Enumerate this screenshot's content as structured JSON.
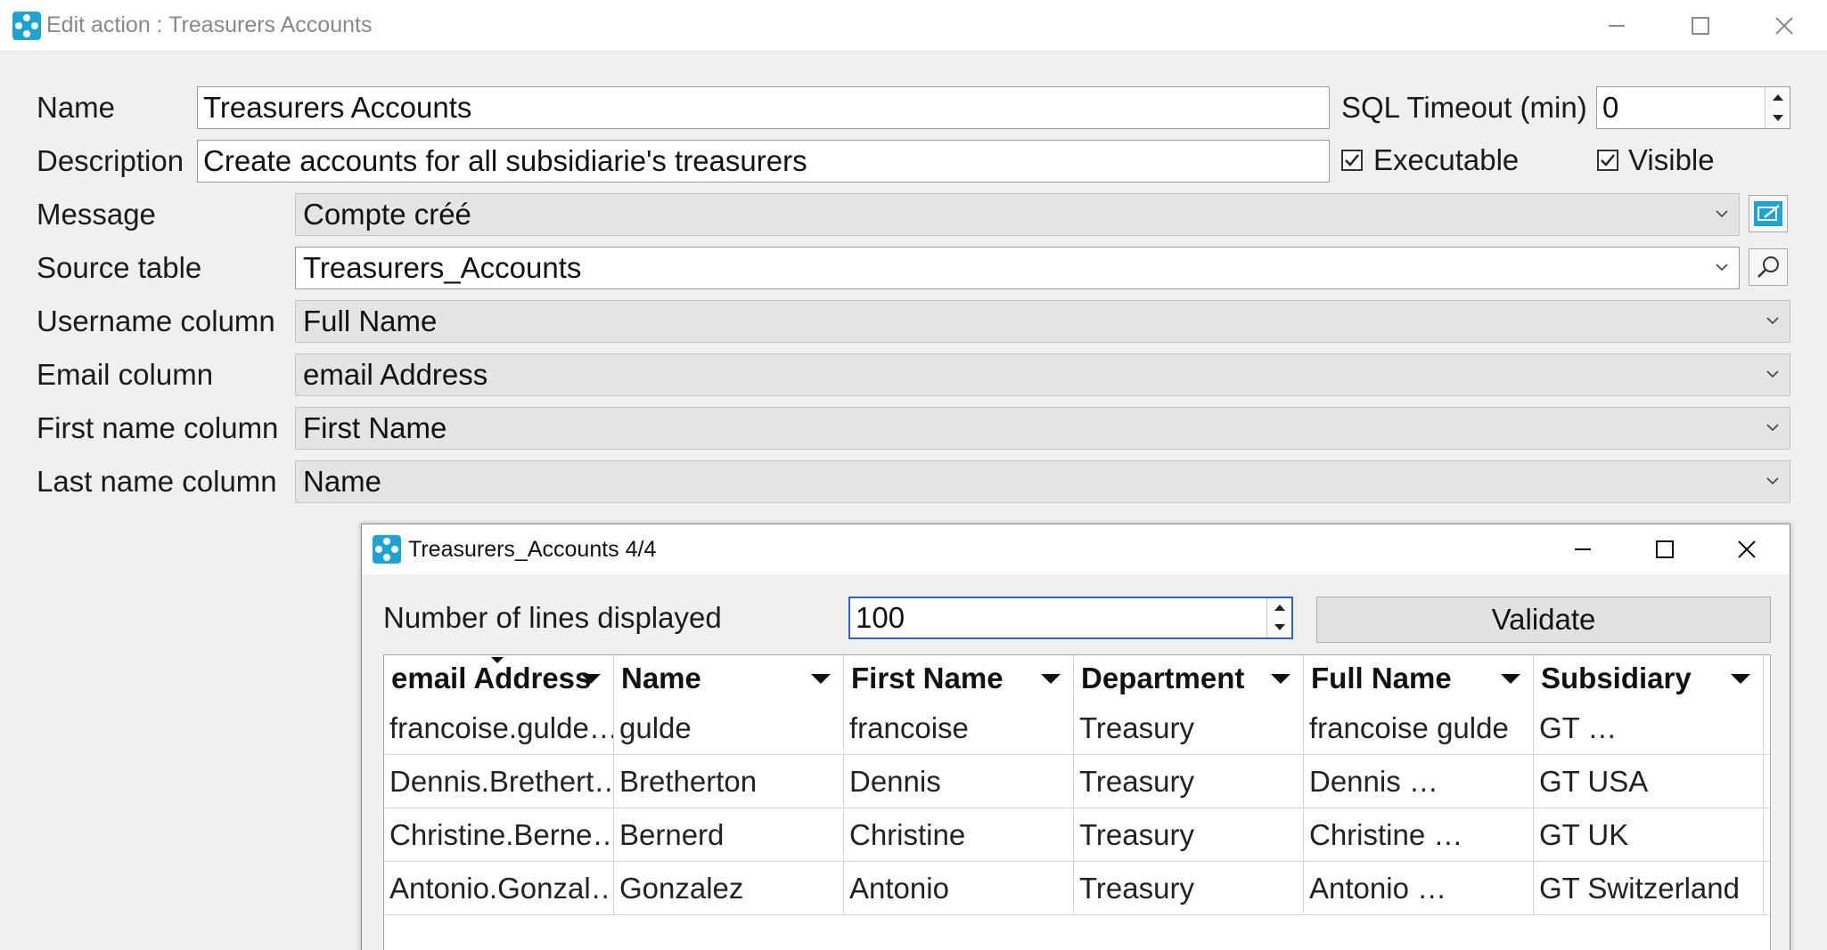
{
  "window": {
    "title": "Edit action : Treasurers Accounts"
  },
  "form": {
    "name_label": "Name",
    "name_value": "Treasurers Accounts",
    "sql_timeout_label": "SQL Timeout (min)",
    "sql_timeout_value": "0",
    "description_label": "Description",
    "description_value": "Create accounts for all subsidiarie's treasurers",
    "executable_label": "Executable",
    "executable_checked": true,
    "visible_label": "Visible",
    "visible_checked": true,
    "message_label": "Message",
    "message_value": "Compte créé",
    "source_table_label": "Source table",
    "source_table_value": "Treasurers_Accounts",
    "username_column_label": "Username column",
    "username_column_value": "Full Name",
    "email_column_label": "Email column",
    "email_column_value": "email Address",
    "first_name_column_label": "First name column",
    "first_name_column_value": "First Name",
    "last_name_column_label": "Last name column",
    "last_name_column_value": "Name"
  },
  "preview": {
    "title": "Treasurers_Accounts 4/4",
    "lines_label": "Number of lines displayed",
    "lines_value": "100",
    "validate_label": "Validate",
    "columns": [
      "email Address",
      "Name",
      "First Name",
      "Department",
      "Full Name",
      "Subsidiary"
    ],
    "rows": [
      [
        "francoise.gulde…",
        "gulde",
        "francoise",
        "Treasury",
        "francoise gulde",
        "GT …"
      ],
      [
        "Dennis.Brethert…",
        "Bretherton",
        "Dennis",
        "Treasury",
        "Dennis …",
        "GT USA"
      ],
      [
        "Christine.Berne…",
        "Bernerd",
        "Christine",
        "Treasury",
        "Christine …",
        "GT UK"
      ],
      [
        "Antonio.Gonzal…",
        "Gonzalez",
        "Antonio",
        "Treasury",
        "Antonio …",
        "GT Switzerland"
      ]
    ]
  },
  "colors": {
    "accent": "#1ea4d2"
  }
}
